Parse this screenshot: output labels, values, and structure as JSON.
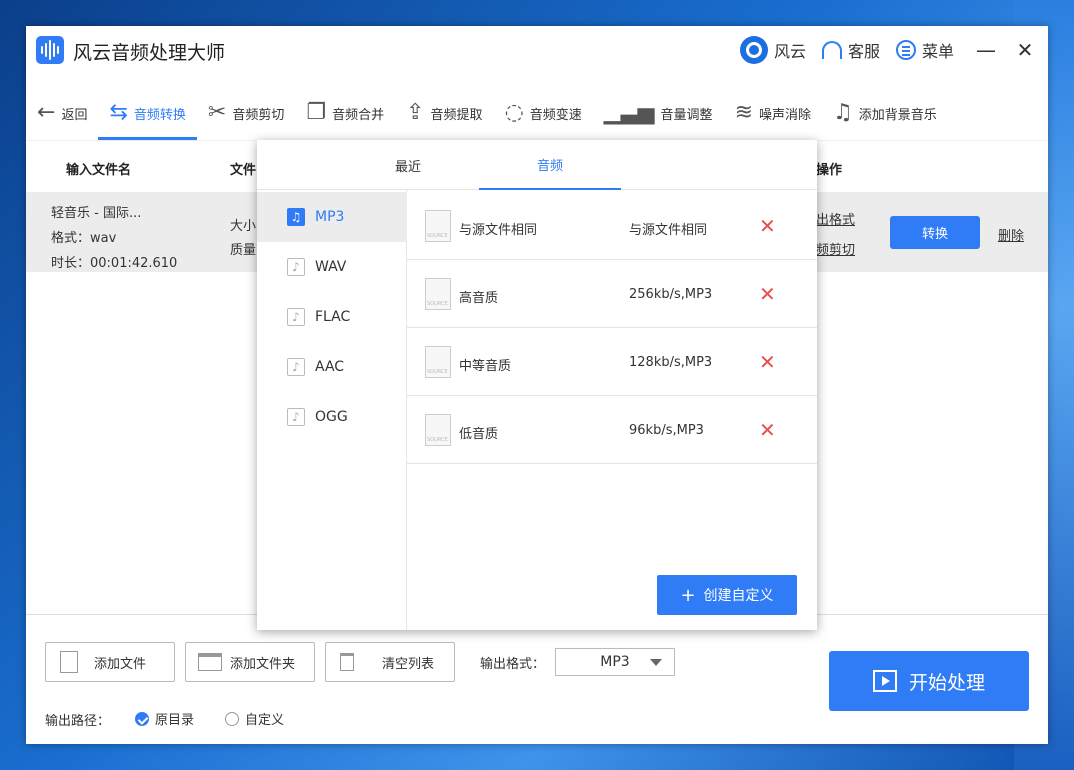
{
  "app": {
    "title": "风云音频处理大师",
    "account_label": "风云",
    "service_label": "客服",
    "menu_label": "菜单",
    "minimize_glyph": "—",
    "close_glyph": "✕"
  },
  "toolbar": {
    "back_label": "返回",
    "tools": [
      {
        "label": "音频转换",
        "icon": "convert-icon"
      },
      {
        "label": "音频剪切",
        "icon": "scissors-icon"
      },
      {
        "label": "音频合并",
        "icon": "merge-icon"
      },
      {
        "label": "音频提取",
        "icon": "extract-icon"
      },
      {
        "label": "音频变速",
        "icon": "speed-icon"
      },
      {
        "label": "音量调整",
        "icon": "volume-icon"
      },
      {
        "label": "噪声消除",
        "icon": "denoise-icon"
      },
      {
        "label": "添加背景音乐",
        "icon": "music-icon"
      }
    ],
    "active": "音频转换"
  },
  "table": {
    "headers": {
      "input": "输入文件名",
      "file": "文件",
      "ops": "操作"
    },
    "row": {
      "name": "轻音乐 - 国际...",
      "format": "格式：wav",
      "duration": "时长：00:01:42.610",
      "size_partial": "大小",
      "quality_partial": "质量",
      "output_format_link": "出格式",
      "cut_link": "频剪切",
      "convert_btn": "转换",
      "delete_link": "删除"
    }
  },
  "popup": {
    "tabs": [
      "最近",
      "音频"
    ],
    "active_tab": "音频",
    "formats": [
      "MP3",
      "WAV",
      "FLAC",
      "AAC",
      "OGG"
    ],
    "active_format": "MP3",
    "qualities": [
      {
        "name": "与源文件相同",
        "spec": "与源文件相同"
      },
      {
        "name": "高音质",
        "spec": "256kb/s,MP3"
      },
      {
        "name": "中等音质",
        "spec": "128kb/s,MP3"
      },
      {
        "name": "低音质",
        "spec": "96kb/s,MP3"
      }
    ],
    "create_custom": "创建自定义"
  },
  "bottom": {
    "add_file": "添加文件",
    "add_folder": "添加文件夹",
    "clear_list": "清空列表",
    "output_format_label": "输出格式：",
    "output_format_value": "MP3",
    "start": "开始处理",
    "output_path_label": "输出路径：",
    "path_original": "原目录",
    "path_custom": "自定义"
  },
  "colors": {
    "accent": "#2f7cf6",
    "delete": "#e65050"
  }
}
